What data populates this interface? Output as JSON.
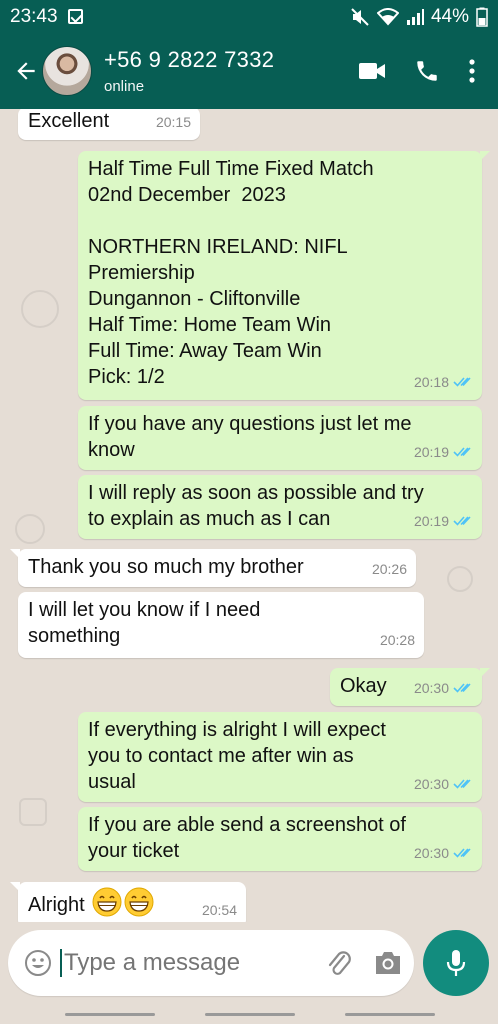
{
  "status_bar": {
    "time": "23:43",
    "battery": "44%"
  },
  "header": {
    "contact_name": "+56 9 2822 7332",
    "contact_status": "online"
  },
  "messages": [
    {
      "dir": "in",
      "text": "Excellent",
      "time": "20:15"
    },
    {
      "dir": "out",
      "text": "Half Time Full Time Fixed Match\n02nd December  2023\n\nNORTHERN IRELAND: NIFL\nPremiership\nDungannon - Cliftonville\nHalf Time: Home Team Win\nFull Time: Away Team Win\nPick: 1/2",
      "time": "20:18"
    },
    {
      "dir": "out",
      "text": "If you have any questions just let me\nknow",
      "time": "20:19"
    },
    {
      "dir": "out",
      "text": "I will reply as soon as possible and try\nto explain as much as I can",
      "time": "20:19"
    },
    {
      "dir": "in",
      "text": "Thank you so much my brother",
      "time": "20:26"
    },
    {
      "dir": "in",
      "text": "I will let you know if I need\nsomething",
      "time": "20:28"
    },
    {
      "dir": "out",
      "text": "Okay",
      "time": "20:30"
    },
    {
      "dir": "out",
      "text": "If everything is alright I will expect\nyou to contact me after win as\nusual",
      "time": "20:30"
    },
    {
      "dir": "out",
      "text": "If you are able send a screenshot of\nyour ticket",
      "time": "20:30"
    },
    {
      "dir": "in",
      "text": "Alright",
      "time": "20:54",
      "emoji": [
        "grinning-face",
        "grinning-face"
      ]
    }
  ],
  "input": {
    "placeholder": "Type a message"
  },
  "colors": {
    "header": "#075e54",
    "outgoing": "#dcf8c6",
    "incoming": "#ffffff",
    "read_ticks": "#4fc3f7",
    "mic_button": "#128c7e"
  }
}
